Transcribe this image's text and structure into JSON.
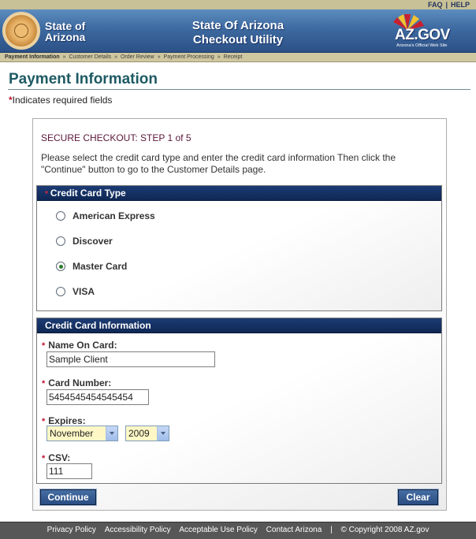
{
  "topbar": {
    "faq": "FAQ",
    "sep": "|",
    "help": "HELP"
  },
  "header": {
    "state_line1": "State of",
    "state_line2": "Arizona",
    "app_title_line1": "State Of Arizona",
    "app_title_line2": "Checkout Utility",
    "logo_text": "AZ.GOV",
    "logo_tagline": "Arizona's Official Web Site"
  },
  "breadcrumb": {
    "sep": "»",
    "items": [
      "Payment Information",
      "Customer Details",
      "Order Review",
      "Payment Processing",
      "Receipt"
    ]
  },
  "page": {
    "title": "Payment Information",
    "required_marker": "*",
    "required_text": "Indicates required fields"
  },
  "panel": {
    "step_title": "SECURE CHECKOUT: STEP 1 of 5",
    "instructions": "Please select the credit card type and enter the credit card information Then click the \"Continue\" button to go to the Customer Details page."
  },
  "card_type": {
    "heading": "Credit Card Type",
    "options": [
      "American Express",
      "Discover",
      "Master Card",
      "VISA"
    ],
    "selected": "Master Card"
  },
  "card_info": {
    "heading": "Credit Card Information",
    "name_label": "Name On Card:",
    "name_value": "Sample Client",
    "number_label": "Card Number:",
    "number_value": "5454545454545454",
    "expires_label": "Expires:",
    "expires_month": "November",
    "expires_year": "2009",
    "csv_label": "CSV:",
    "csv_value": "111"
  },
  "buttons": {
    "continue": "Continue",
    "clear": "Clear"
  },
  "footer": {
    "links": [
      "Privacy Policy",
      "Accessibility Policy",
      "Acceptable Use Policy",
      "Contact Arizona"
    ],
    "sep": "|",
    "copyright": "© Copyright 2008 AZ.gov"
  },
  "colors": {
    "header_blue": "#3d6aa0",
    "section_navy": "#1c3c74",
    "title_teal": "#1e5a63",
    "required_red": "#c0142f",
    "select_yellow": "#fff8c6"
  }
}
